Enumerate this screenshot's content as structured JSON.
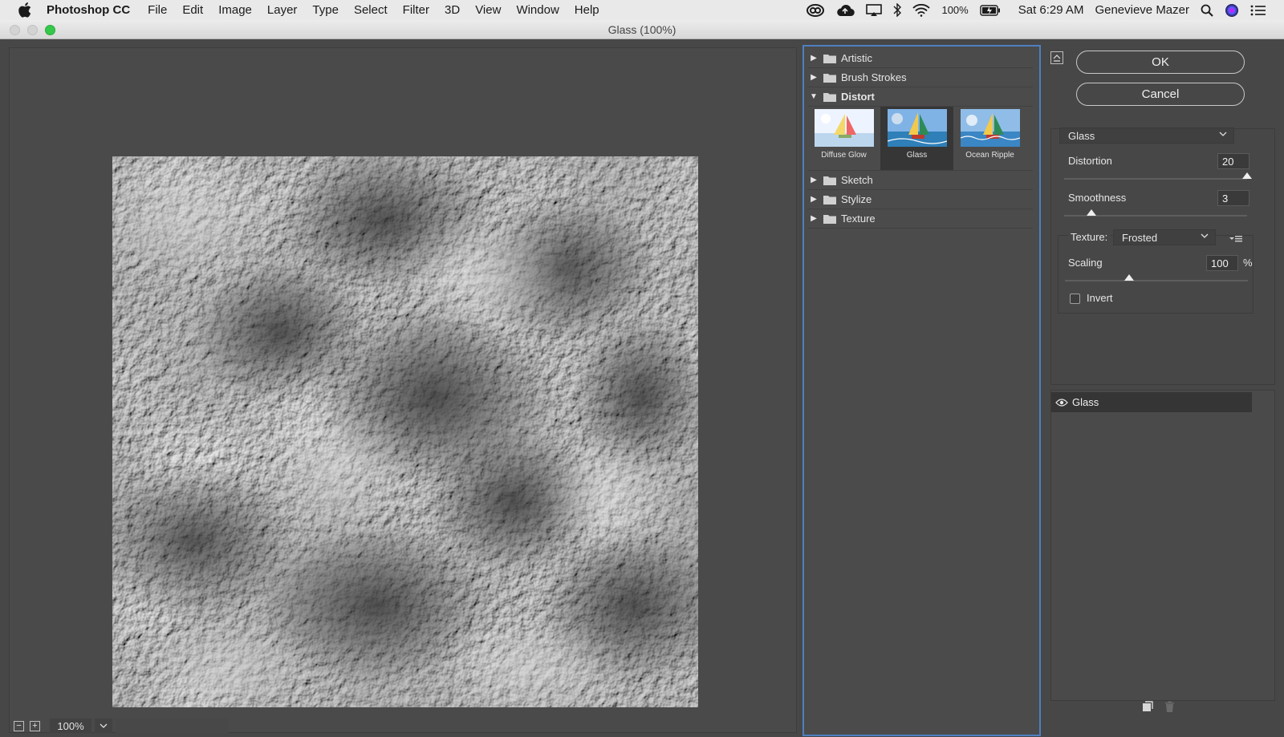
{
  "menubar": {
    "app_name": "Photoshop CC",
    "menus": [
      "File",
      "Edit",
      "Image",
      "Layer",
      "Type",
      "Select",
      "Filter",
      "3D",
      "View",
      "Window",
      "Help"
    ],
    "battery": "100%",
    "clock": "Sat 6:29 AM",
    "user": "Genevieve Mazer"
  },
  "window": {
    "title": "Glass (100%)"
  },
  "preview": {
    "zoom": "100%"
  },
  "gallery": {
    "categories_top": [
      {
        "label": "Artistic"
      },
      {
        "label": "Brush Strokes"
      }
    ],
    "open_category": "Distort",
    "thumbnails": [
      {
        "label": "Diffuse Glow",
        "selected": false
      },
      {
        "label": "Glass",
        "selected": true
      },
      {
        "label": "Ocean Ripple",
        "selected": false
      }
    ],
    "categories_bottom": [
      {
        "label": "Sketch"
      },
      {
        "label": "Stylize"
      },
      {
        "label": "Texture"
      }
    ]
  },
  "controls": {
    "ok_label": "OK",
    "cancel_label": "Cancel",
    "filter_select": "Glass",
    "distortion_label": "Distortion",
    "distortion_value": "20",
    "distortion_fraction": 1.0,
    "smoothness_label": "Smoothness",
    "smoothness_value": "3",
    "smoothness_fraction": 0.15,
    "texture_label": "Texture:",
    "texture_value": "Frosted",
    "scaling_label": "Scaling",
    "scaling_value": "100",
    "scaling_unit": "%",
    "scaling_fraction": 0.35,
    "invert_label": "Invert",
    "invert_checked": false
  },
  "layers": {
    "items": [
      {
        "label": "Glass",
        "visible": true
      }
    ]
  },
  "colors": {
    "accent_border": "#4e7fc0",
    "maximize_green": "#35c84a",
    "panel_bg": "#474747"
  }
}
